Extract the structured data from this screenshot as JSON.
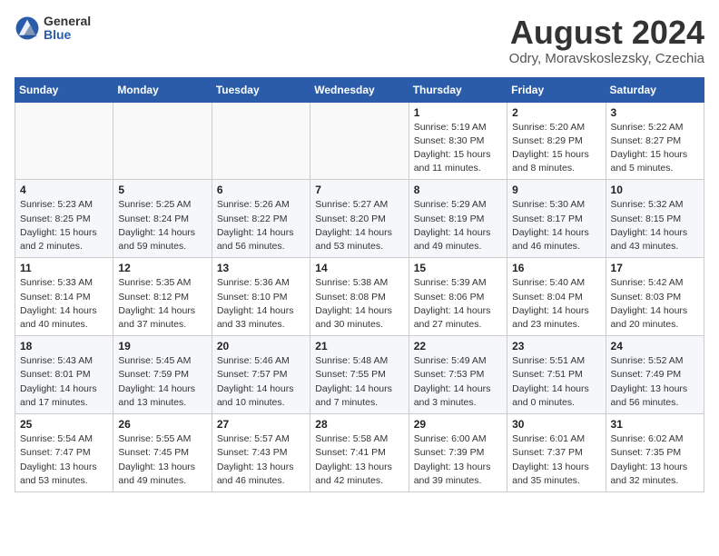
{
  "header": {
    "logo_general": "General",
    "logo_blue": "Blue",
    "month_title": "August 2024",
    "location": "Odry, Moravskoslezsky, Czechia"
  },
  "weekdays": [
    "Sunday",
    "Monday",
    "Tuesday",
    "Wednesday",
    "Thursday",
    "Friday",
    "Saturday"
  ],
  "weeks": [
    [
      {
        "day": "",
        "info": ""
      },
      {
        "day": "",
        "info": ""
      },
      {
        "day": "",
        "info": ""
      },
      {
        "day": "",
        "info": ""
      },
      {
        "day": "1",
        "info": "Sunrise: 5:19 AM\nSunset: 8:30 PM\nDaylight: 15 hours\nand 11 minutes."
      },
      {
        "day": "2",
        "info": "Sunrise: 5:20 AM\nSunset: 8:29 PM\nDaylight: 15 hours\nand 8 minutes."
      },
      {
        "day": "3",
        "info": "Sunrise: 5:22 AM\nSunset: 8:27 PM\nDaylight: 15 hours\nand 5 minutes."
      }
    ],
    [
      {
        "day": "4",
        "info": "Sunrise: 5:23 AM\nSunset: 8:25 PM\nDaylight: 15 hours\nand 2 minutes."
      },
      {
        "day": "5",
        "info": "Sunrise: 5:25 AM\nSunset: 8:24 PM\nDaylight: 14 hours\nand 59 minutes."
      },
      {
        "day": "6",
        "info": "Sunrise: 5:26 AM\nSunset: 8:22 PM\nDaylight: 14 hours\nand 56 minutes."
      },
      {
        "day": "7",
        "info": "Sunrise: 5:27 AM\nSunset: 8:20 PM\nDaylight: 14 hours\nand 53 minutes."
      },
      {
        "day": "8",
        "info": "Sunrise: 5:29 AM\nSunset: 8:19 PM\nDaylight: 14 hours\nand 49 minutes."
      },
      {
        "day": "9",
        "info": "Sunrise: 5:30 AM\nSunset: 8:17 PM\nDaylight: 14 hours\nand 46 minutes."
      },
      {
        "day": "10",
        "info": "Sunrise: 5:32 AM\nSunset: 8:15 PM\nDaylight: 14 hours\nand 43 minutes."
      }
    ],
    [
      {
        "day": "11",
        "info": "Sunrise: 5:33 AM\nSunset: 8:14 PM\nDaylight: 14 hours\nand 40 minutes."
      },
      {
        "day": "12",
        "info": "Sunrise: 5:35 AM\nSunset: 8:12 PM\nDaylight: 14 hours\nand 37 minutes."
      },
      {
        "day": "13",
        "info": "Sunrise: 5:36 AM\nSunset: 8:10 PM\nDaylight: 14 hours\nand 33 minutes."
      },
      {
        "day": "14",
        "info": "Sunrise: 5:38 AM\nSunset: 8:08 PM\nDaylight: 14 hours\nand 30 minutes."
      },
      {
        "day": "15",
        "info": "Sunrise: 5:39 AM\nSunset: 8:06 PM\nDaylight: 14 hours\nand 27 minutes."
      },
      {
        "day": "16",
        "info": "Sunrise: 5:40 AM\nSunset: 8:04 PM\nDaylight: 14 hours\nand 23 minutes."
      },
      {
        "day": "17",
        "info": "Sunrise: 5:42 AM\nSunset: 8:03 PM\nDaylight: 14 hours\nand 20 minutes."
      }
    ],
    [
      {
        "day": "18",
        "info": "Sunrise: 5:43 AM\nSunset: 8:01 PM\nDaylight: 14 hours\nand 17 minutes."
      },
      {
        "day": "19",
        "info": "Sunrise: 5:45 AM\nSunset: 7:59 PM\nDaylight: 14 hours\nand 13 minutes."
      },
      {
        "day": "20",
        "info": "Sunrise: 5:46 AM\nSunset: 7:57 PM\nDaylight: 14 hours\nand 10 minutes."
      },
      {
        "day": "21",
        "info": "Sunrise: 5:48 AM\nSunset: 7:55 PM\nDaylight: 14 hours\nand 7 minutes."
      },
      {
        "day": "22",
        "info": "Sunrise: 5:49 AM\nSunset: 7:53 PM\nDaylight: 14 hours\nand 3 minutes."
      },
      {
        "day": "23",
        "info": "Sunrise: 5:51 AM\nSunset: 7:51 PM\nDaylight: 14 hours\nand 0 minutes."
      },
      {
        "day": "24",
        "info": "Sunrise: 5:52 AM\nSunset: 7:49 PM\nDaylight: 13 hours\nand 56 minutes."
      }
    ],
    [
      {
        "day": "25",
        "info": "Sunrise: 5:54 AM\nSunset: 7:47 PM\nDaylight: 13 hours\nand 53 minutes."
      },
      {
        "day": "26",
        "info": "Sunrise: 5:55 AM\nSunset: 7:45 PM\nDaylight: 13 hours\nand 49 minutes."
      },
      {
        "day": "27",
        "info": "Sunrise: 5:57 AM\nSunset: 7:43 PM\nDaylight: 13 hours\nand 46 minutes."
      },
      {
        "day": "28",
        "info": "Sunrise: 5:58 AM\nSunset: 7:41 PM\nDaylight: 13 hours\nand 42 minutes."
      },
      {
        "day": "29",
        "info": "Sunrise: 6:00 AM\nSunset: 7:39 PM\nDaylight: 13 hours\nand 39 minutes."
      },
      {
        "day": "30",
        "info": "Sunrise: 6:01 AM\nSunset: 7:37 PM\nDaylight: 13 hours\nand 35 minutes."
      },
      {
        "day": "31",
        "info": "Sunrise: 6:02 AM\nSunset: 7:35 PM\nDaylight: 13 hours\nand 32 minutes."
      }
    ]
  ]
}
